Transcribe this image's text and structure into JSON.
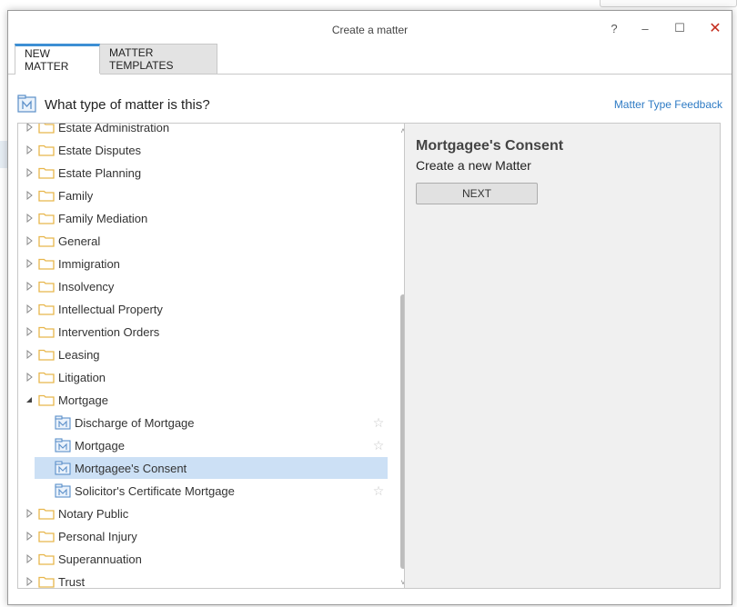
{
  "window": {
    "title": "Create a matter",
    "help_glyph": "?",
    "min_glyph": "–",
    "max_glyph": "☐",
    "close_glyph": "✕"
  },
  "tabs": [
    {
      "label": "NEW MATTER",
      "active": true
    },
    {
      "label": "MATTER TEMPLATES",
      "active": false
    }
  ],
  "question": {
    "icon": "matter-type-icon",
    "text": "What type of matter is this?",
    "feedback_link": "Matter Type Feedback"
  },
  "tree": {
    "items": [
      {
        "label": "Estate Administration",
        "type": "folder",
        "expanded": false
      },
      {
        "label": "Estate Disputes",
        "type": "folder",
        "expanded": false
      },
      {
        "label": "Estate Planning",
        "type": "folder",
        "expanded": false
      },
      {
        "label": "Family",
        "type": "folder",
        "expanded": false
      },
      {
        "label": "Family Mediation",
        "type": "folder",
        "expanded": false
      },
      {
        "label": "General",
        "type": "folder",
        "expanded": false
      },
      {
        "label": "Immigration",
        "type": "folder",
        "expanded": false
      },
      {
        "label": "Insolvency",
        "type": "folder",
        "expanded": false
      },
      {
        "label": "Intellectual Property",
        "type": "folder",
        "expanded": false
      },
      {
        "label": "Intervention Orders",
        "type": "folder",
        "expanded": false
      },
      {
        "label": "Leasing",
        "type": "folder",
        "expanded": false
      },
      {
        "label": "Litigation",
        "type": "folder",
        "expanded": false
      },
      {
        "label": "Mortgage",
        "type": "folder",
        "expanded": true
      },
      {
        "label": "Discharge of Mortgage",
        "type": "matter",
        "selected": false
      },
      {
        "label": "Mortgage",
        "type": "matter",
        "selected": false
      },
      {
        "label": "Mortgagee's Consent",
        "type": "matter",
        "selected": true
      },
      {
        "label": "Solicitor's Certificate Mortgage",
        "type": "matter",
        "selected": false
      },
      {
        "label": "Notary Public",
        "type": "folder",
        "expanded": false
      },
      {
        "label": "Personal Injury",
        "type": "folder",
        "expanded": false
      },
      {
        "label": "Superannuation",
        "type": "folder",
        "expanded": false
      },
      {
        "label": "Trust",
        "type": "folder",
        "expanded": false
      }
    ],
    "star_glyph": "☆"
  },
  "detail": {
    "title": "Mortgagee's Consent",
    "subtitle": "Create a new Matter",
    "next_label": "NEXT"
  },
  "colors": {
    "accent": "#3d8fd4",
    "link": "#2e7bc4",
    "selected_row": "#cce0f5",
    "folder": "#e8b64c",
    "matter_icon": "#5b8fc9",
    "close": "#c42b1c"
  }
}
